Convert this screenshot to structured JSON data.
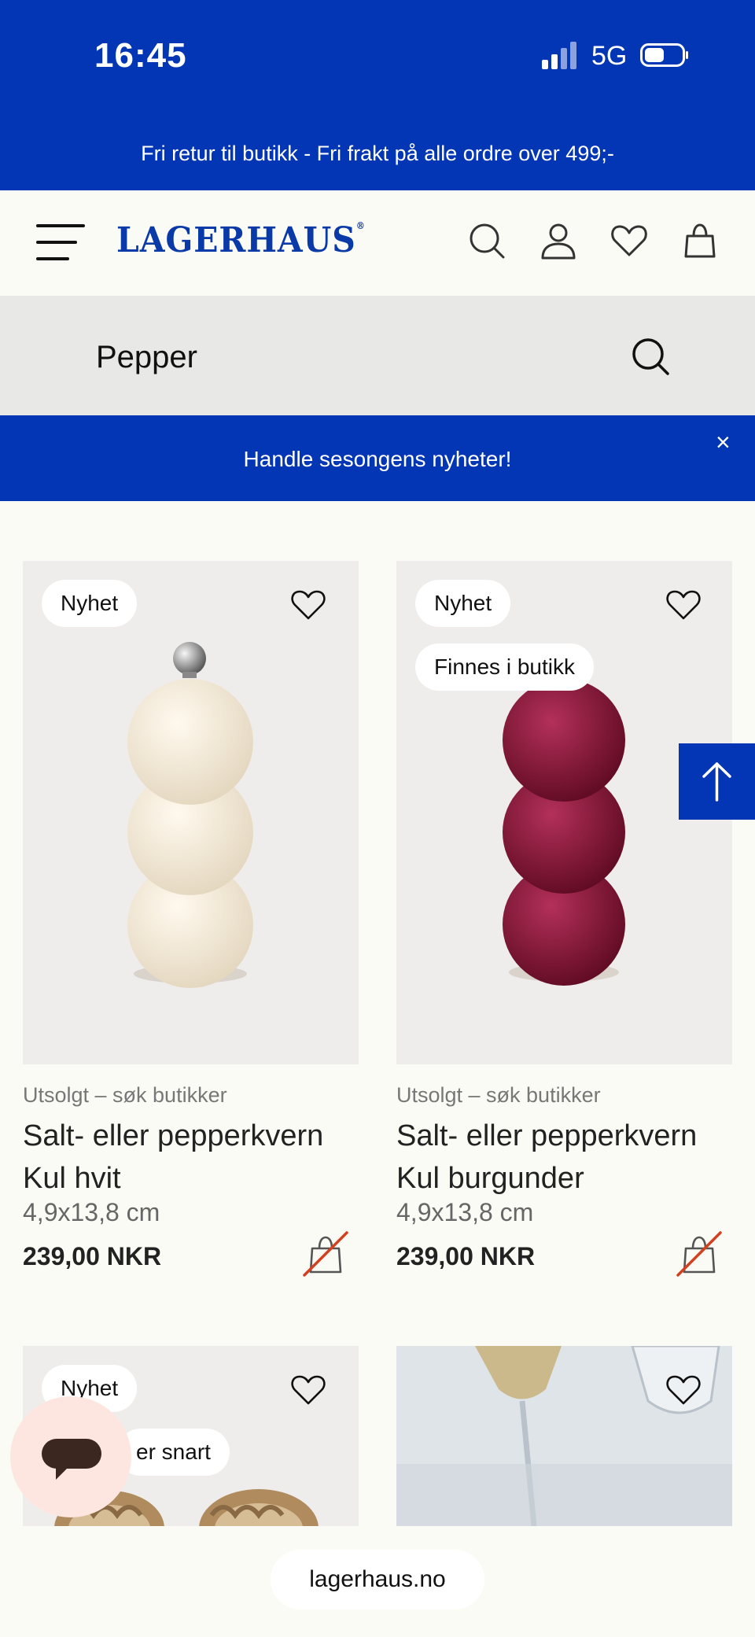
{
  "status_bar": {
    "time": "16:45",
    "network": "5G"
  },
  "promo_bar": {
    "text": "Fri retur til butikk - Fri frakt på alle ordre over 499;-"
  },
  "header": {
    "logo": "LAGERHAUS",
    "logo_mark": "®"
  },
  "search": {
    "value": "Pepper"
  },
  "banner": {
    "text": "Handle sesongens nyheter!",
    "close": "×"
  },
  "products": [
    {
      "badges": [
        "Nyhet"
      ],
      "stock": "Utsolgt – søk butikker",
      "name_line1": "Salt- eller pepperkvern",
      "name_line2": "Kul hvit",
      "size": "4,9x13,8 cm",
      "price": "239,00 NKR",
      "color": "#f1e7d6"
    },
    {
      "badges": [
        "Nyhet",
        "Finnes i butikk"
      ],
      "stock": "Utsolgt – søk butikker",
      "name_line1": "Salt- eller pepperkvern",
      "name_line2": "Kul burgunder",
      "size": "4,9x13,8 cm",
      "price": "239,00 NKR",
      "color": "#7a0f2c"
    },
    {
      "badges": [
        "Nyhet",
        "er snart"
      ]
    },
    {
      "badges": []
    }
  ],
  "footer": {
    "url": "lagerhaus.no"
  },
  "icons": {
    "menu": "menu-icon",
    "search": "search-icon",
    "account": "user-icon",
    "wishlist": "heart-icon",
    "cart": "bag-icon",
    "scroll_top": "arrow-up-icon",
    "chat": "chat-icon",
    "not_buyable": "bag-crossed-icon"
  },
  "colors": {
    "brand_blue": "#0336b4",
    "slash_red": "#d2401f"
  }
}
